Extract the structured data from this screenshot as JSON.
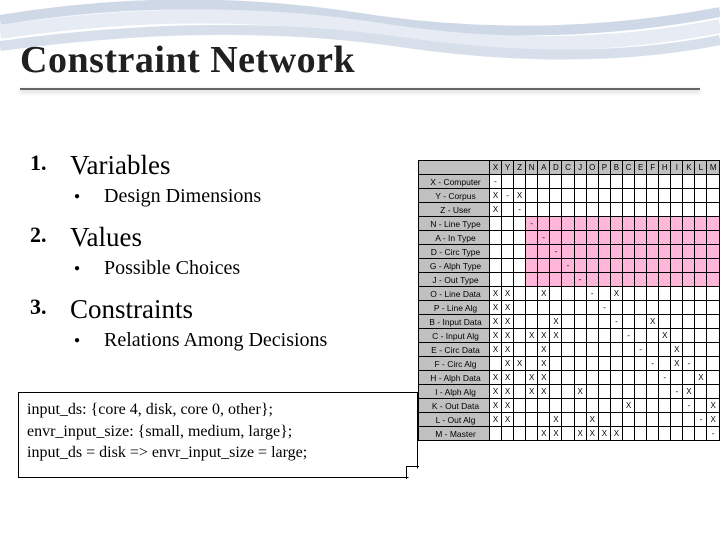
{
  "title": "Constraint Network",
  "items": [
    {
      "num": "1.",
      "head": "Variables",
      "sub": "Design Dimensions"
    },
    {
      "num": "2.",
      "head": "Values",
      "sub": "Possible Choices"
    },
    {
      "num": "3.",
      "head": "Constraints",
      "sub": "Relations Among Decisions"
    }
  ],
  "code": {
    "l1": "input_ds: {core 4, disk, core 0, other};",
    "l2": "envr_input_size: {small, medium, large};",
    "l3": "input_ds = disk => envr_input_size = large;"
  },
  "matrix": {
    "cols": [
      "X",
      "Y",
      "Z",
      "N",
      "A",
      "D",
      "C",
      "J",
      "O",
      "P",
      "B",
      "C",
      "E",
      "F",
      "H",
      "I",
      "K",
      "L",
      "M"
    ],
    "rows": [
      {
        "h": "X - Computer",
        "m": [
          "-",
          "",
          "",
          "",
          "",
          "",
          "",
          "",
          "",
          "",
          "",
          "",
          "",
          "",
          "",
          "",
          "",
          "",
          ""
        ]
      },
      {
        "h": "Y - Corpus",
        "m": [
          "X",
          "-",
          "X",
          "",
          "",
          "",
          "",
          "",
          "",
          "",
          "",
          "",
          "",
          "",
          "",
          "",
          "",
          "",
          ""
        ]
      },
      {
        "h": "Z - User",
        "m": [
          "X",
          "",
          "-",
          "",
          "",
          "",
          "",
          "",
          "",
          "",
          "",
          "",
          "",
          "",
          "",
          "",
          "",
          "",
          ""
        ]
      },
      {
        "h": "N - Line Type",
        "m": [
          "",
          "",
          "",
          "-",
          "",
          "",
          "",
          "",
          "",
          "",
          "",
          "",
          "",
          "",
          "",
          "",
          "",
          "",
          ""
        ]
      },
      {
        "h": "A - In Type",
        "m": [
          "",
          "",
          "",
          "",
          "-",
          "",
          "",
          "",
          "",
          "",
          "",
          "",
          "",
          "",
          "",
          "",
          "",
          "",
          ""
        ]
      },
      {
        "h": "D - Circ Type",
        "m": [
          "",
          "",
          "",
          "",
          "",
          "-",
          "",
          "",
          "",
          "",
          "",
          "",
          "",
          "",
          "",
          "",
          "",
          "",
          ""
        ]
      },
      {
        "h": "G - Alph Type",
        "m": [
          "",
          "",
          "",
          "",
          "",
          "",
          "-",
          "",
          "",
          "",
          "",
          "",
          "",
          "",
          "",
          "",
          "",
          "",
          ""
        ]
      },
      {
        "h": "J - Out Type",
        "m": [
          "",
          "",
          "",
          "",
          "",
          "",
          "",
          "-",
          "",
          "",
          "",
          "",
          "",
          "",
          "",
          "",
          "",
          "",
          ""
        ]
      },
      {
        "h": "O - Line Data",
        "m": [
          "X",
          "X",
          "",
          "",
          "X",
          "",
          "",
          "",
          "-",
          "",
          "X",
          "",
          "",
          "",
          "",
          "",
          "",
          "",
          ""
        ]
      },
      {
        "h": "P - Line Alg",
        "m": [
          "X",
          "X",
          "",
          "",
          "",
          "",
          "",
          "",
          "",
          "-",
          "",
          "",
          "",
          "",
          "",
          "",
          "",
          "",
          ""
        ]
      },
      {
        "h": "B - Input Data",
        "m": [
          "X",
          "X",
          "",
          "",
          "",
          "X",
          "",
          "",
          "",
          "",
          "-",
          "",
          "",
          "X",
          "",
          "",
          "",
          "",
          ""
        ]
      },
      {
        "h": "C - Input Alg",
        "m": [
          "X",
          "X",
          "",
          "X",
          "X",
          "X",
          "",
          "",
          "",
          "",
          "",
          "-",
          "",
          "",
          "X",
          "",
          "",
          "",
          ""
        ]
      },
      {
        "h": "E - Circ Data",
        "m": [
          "X",
          "X",
          "",
          "",
          "X",
          "",
          "",
          "",
          "",
          "",
          "",
          "",
          "-",
          "",
          "",
          "X",
          "",
          "",
          ""
        ]
      },
      {
        "h": "F - Circ Alg",
        "m": [
          "",
          "X",
          "X",
          "",
          "X",
          "",
          "",
          "",
          "",
          "",
          "",
          "",
          "",
          "-",
          "",
          "X",
          "-",
          "",
          ""
        ]
      },
      {
        "h": "H - Alph Data",
        "m": [
          "X",
          "X",
          "",
          "X",
          "X",
          "",
          "",
          "",
          "",
          "",
          "",
          "",
          "",
          "",
          "-",
          "",
          "",
          "X",
          ""
        ]
      },
      {
        "h": "I - Alph Alg",
        "m": [
          "X",
          "X",
          "",
          "X",
          "X",
          "",
          "",
          "X",
          "",
          "",
          "",
          "",
          "",
          "",
          "",
          "-",
          "X",
          "",
          ""
        ]
      },
      {
        "h": "K - Out Data",
        "m": [
          "X",
          "X",
          "",
          "",
          "",
          "",
          "",
          "",
          "",
          "",
          "",
          "X",
          "",
          "",
          "",
          "",
          "-",
          "",
          "X"
        ]
      },
      {
        "h": "L - Out Alg",
        "m": [
          "X",
          "X",
          "",
          "",
          "",
          "X",
          "",
          "",
          "X",
          "",
          "",
          "",
          "",
          "",
          "",
          "",
          "",
          "-",
          "X"
        ]
      },
      {
        "h": "M - Master",
        "m": [
          "",
          "",
          "",
          "",
          "X",
          "X",
          "",
          "X",
          "X",
          "X",
          "X",
          "",
          "",
          "",
          "",
          "",
          "",
          "",
          "-"
        ]
      }
    ],
    "pinkRows": [
      3,
      4,
      5,
      6,
      7
    ]
  }
}
